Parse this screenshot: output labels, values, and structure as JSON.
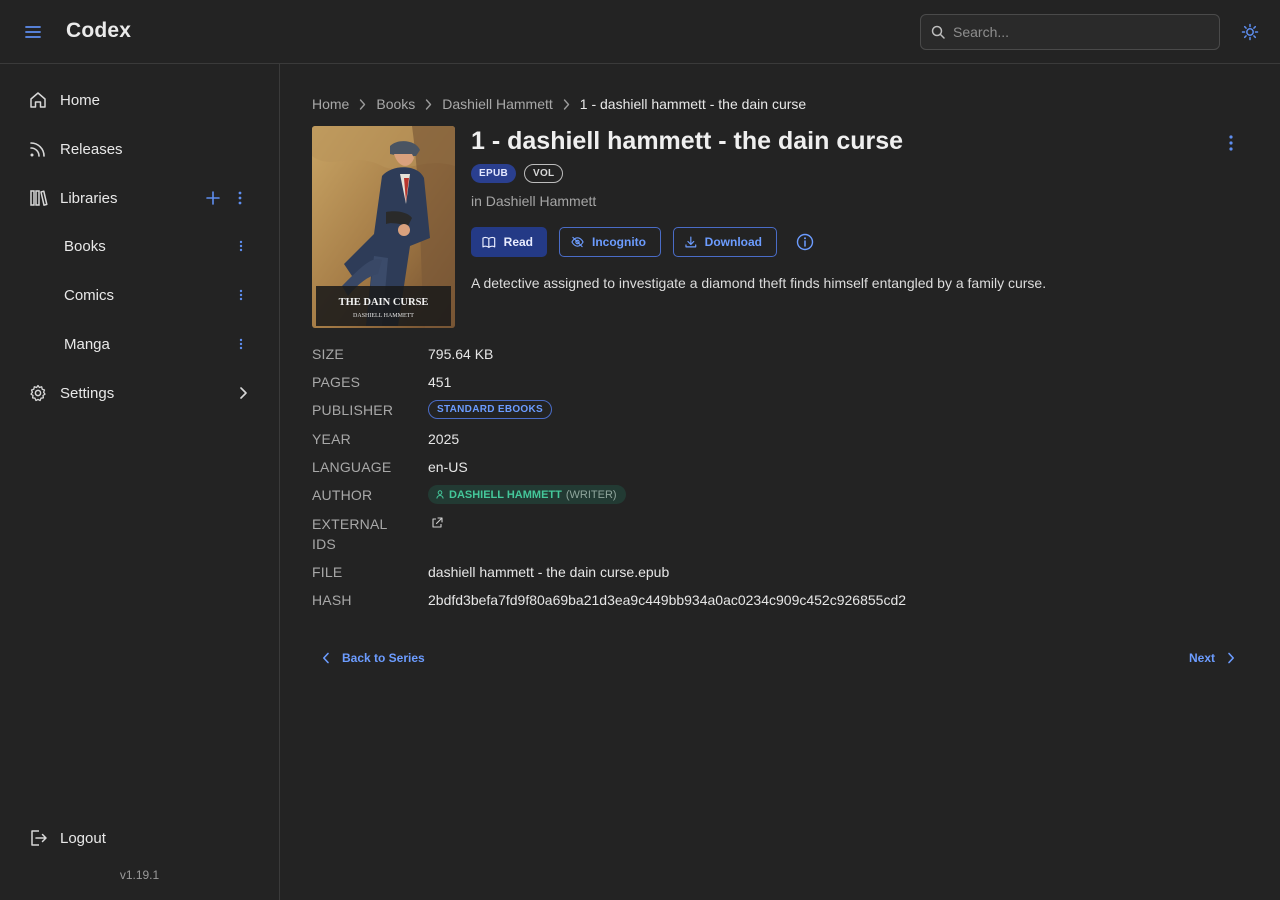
{
  "app": {
    "title": "Codex",
    "version": "v1.19.1"
  },
  "header": {
    "search_placeholder": "Search..."
  },
  "sidebar": {
    "home": "Home",
    "releases": "Releases",
    "libraries": "Libraries",
    "library_items": [
      "Books",
      "Comics",
      "Manga"
    ],
    "settings": "Settings",
    "logout": "Logout"
  },
  "breadcrumb": [
    "Home",
    "Books",
    "Dashiell Hammett",
    "1 - dashiell hammett - the dain curse"
  ],
  "book": {
    "title": "1 - dashiell hammett - the dain curse",
    "badges": [
      "EPUB",
      "VOL"
    ],
    "series_line": "in Dashiell Hammett",
    "description": "A detective assigned to investigate a diamond theft finds himself entangled by a family curse.",
    "cover": {
      "title": "THE DAIN CURSE",
      "author": "DASHIELL HAMMETT"
    }
  },
  "actions": {
    "read": "Read",
    "incognito": "Incognito",
    "download": "Download"
  },
  "metadata": {
    "size_label": "SIZE",
    "size": "795.64 KB",
    "pages_label": "PAGES",
    "pages": "451",
    "publisher_label": "PUBLISHER",
    "publisher": "STANDARD EBOOKS",
    "year_label": "YEAR",
    "year": "2025",
    "language_label": "LANGUAGE",
    "language": "en-US",
    "author_label": "AUTHOR",
    "author": "DASHIELL HAMMETT",
    "author_role": "(WRITER)",
    "external_ids_label_1": "EXTERNAL",
    "external_ids_label_2": "IDS",
    "file_label": "FILE",
    "file": "dashiell hammett - the dain curse.epub",
    "hash_label": "HASH",
    "hash": "2bdfd3befa7fd9f80a69ba21d3ea9c449bb934a0ac0234c909c452c926855cd2"
  },
  "navigation": {
    "back": "Back to Series",
    "next": "Next"
  },
  "colors": {
    "accent": "#6c9cff",
    "primary_button": "#243a86",
    "author_chip_text": "#44c79a",
    "background": "#232323"
  },
  "icons": [
    "menu-icon",
    "search-icon",
    "sun-icon",
    "home-icon",
    "rss-icon",
    "library-icon",
    "plus-icon",
    "kebab-icon",
    "gear-icon",
    "chevron-right-icon",
    "logout-icon",
    "book-open-icon",
    "eye-off-icon",
    "download-icon",
    "info-icon",
    "person-icon",
    "external-link-icon",
    "chevron-left-icon"
  ]
}
